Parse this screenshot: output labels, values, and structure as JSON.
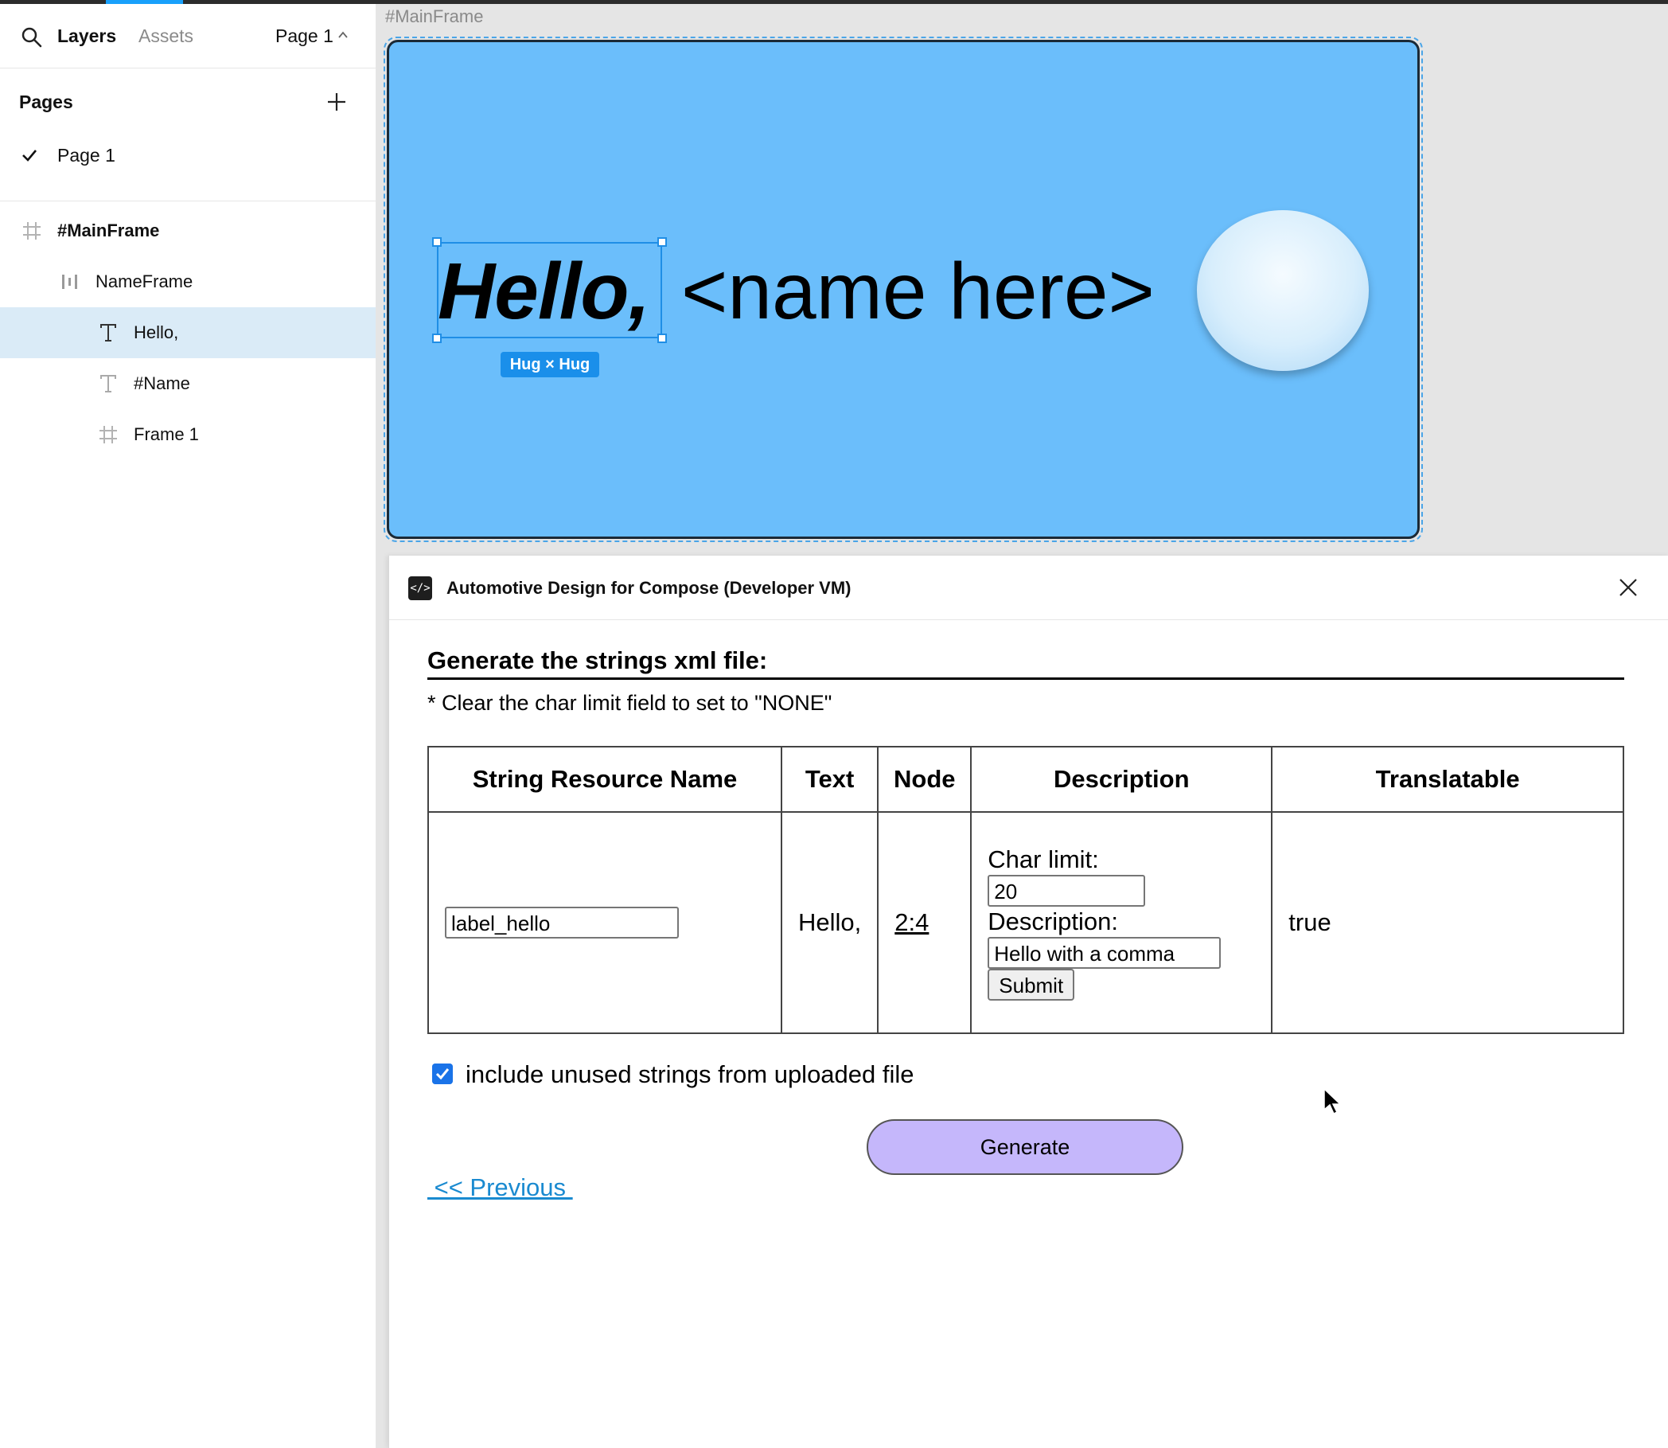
{
  "sidebar": {
    "tabs": {
      "layers": "Layers",
      "assets": "Assets",
      "page": "Page 1"
    },
    "pages_header": "Pages",
    "pages": [
      {
        "label": "Page 1",
        "selected": true
      }
    ],
    "layers": [
      {
        "label": "#MainFrame",
        "icon": "frame-icon"
      },
      {
        "label": "NameFrame",
        "icon": "auto-layout-icon"
      },
      {
        "label": "Hello,",
        "icon": "text-icon",
        "selected": true
      },
      {
        "label": "#Name",
        "icon": "text-icon"
      },
      {
        "label": "Frame 1",
        "icon": "frame-icon"
      }
    ]
  },
  "canvas": {
    "frame_label": "#MainFrame",
    "hello_text": "Hello,",
    "name_text": "<name here>",
    "size_badge": "Hug × Hug",
    "frame_color": "#6bbefb"
  },
  "plugin": {
    "title": "Automotive Design for Compose (Developer VM)",
    "heading": "Generate the strings xml file:",
    "hint": "* Clear the char limit field to set to \"NONE\"",
    "table": {
      "headers": [
        "String Resource Name",
        "Text",
        "Node",
        "Description",
        "Translatable"
      ],
      "rows": [
        {
          "resource_name": "label_hello",
          "text": "Hello,",
          "node": "2:4",
          "char_limit_label": "Char limit:",
          "char_limit": "20",
          "description_label": "Description:",
          "description": "Hello with a comma",
          "submit": "Submit",
          "translatable": "true"
        }
      ]
    },
    "include_unused_label": "include unused strings from uploaded file",
    "include_unused_checked": true,
    "generate_label": "Generate",
    "previous_label": " << Previous "
  }
}
